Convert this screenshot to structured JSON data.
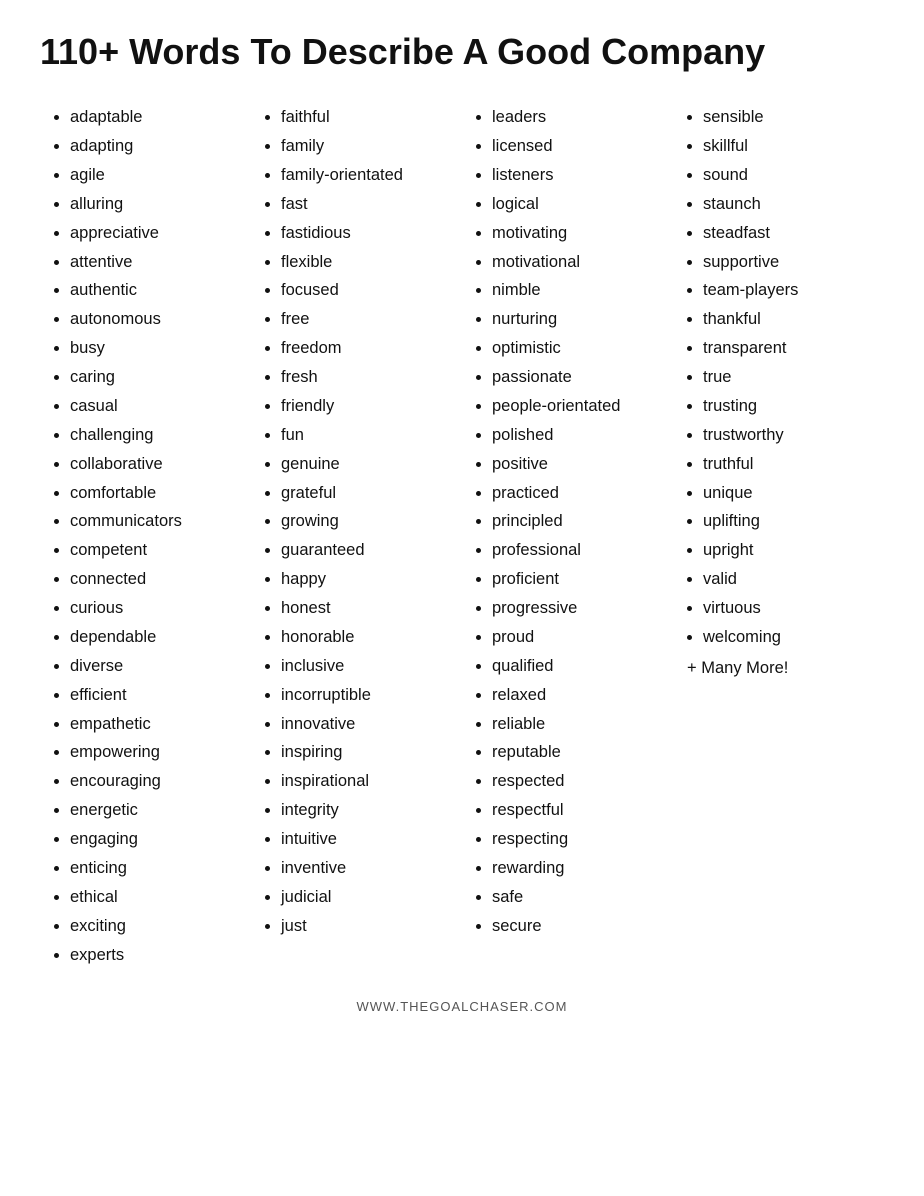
{
  "title": "110+ Words To Describe A Good Company",
  "columns": [
    {
      "id": "col1",
      "items": [
        "adaptable",
        "adapting",
        "agile",
        "alluring",
        "appreciative",
        "attentive",
        "authentic",
        "autonomous",
        "busy",
        "caring",
        "casual",
        "challenging",
        "collaborative",
        "comfortable",
        "communicators",
        "competent",
        "connected",
        "curious",
        "dependable",
        "diverse",
        "efficient",
        "empathetic",
        "empowering",
        "encouraging",
        "energetic",
        "engaging",
        "enticing",
        "ethical",
        "exciting",
        "experts"
      ]
    },
    {
      "id": "col2",
      "items": [
        "faithful",
        "family",
        "family-orientated",
        "fast",
        "fastidious",
        "flexible",
        "focused",
        "free",
        "freedom",
        "fresh",
        "friendly",
        "fun",
        "genuine",
        "grateful",
        "growing",
        "guaranteed",
        "happy",
        "honest",
        "honorable",
        "inclusive",
        "incorruptible",
        "innovative",
        "inspiring",
        "inspirational",
        "integrity",
        "intuitive",
        "inventive",
        "judicial",
        "just"
      ]
    },
    {
      "id": "col3",
      "items": [
        "leaders",
        "licensed",
        "listeners",
        "logical",
        "motivating",
        "motivational",
        "nimble",
        "nurturing",
        "optimistic",
        "passionate",
        "people-orientated",
        "polished",
        "positive",
        "practiced",
        "principled",
        "professional",
        "proficient",
        "progressive",
        "proud",
        "qualified",
        "relaxed",
        "reliable",
        "reputable",
        "respected",
        "respectful",
        "respecting",
        "rewarding",
        "safe",
        "secure"
      ]
    },
    {
      "id": "col4",
      "items": [
        "sensible",
        "skillful",
        "sound",
        "staunch",
        "steadfast",
        "supportive",
        "team-players",
        "thankful",
        "transparent",
        "true",
        "trusting",
        "trustworthy",
        "truthful",
        "unique",
        "uplifting",
        "upright",
        "valid",
        "virtuous",
        "welcoming"
      ],
      "extra": "+ Many More!"
    }
  ],
  "footer": "WWW.THEGOALCHASER.COM"
}
